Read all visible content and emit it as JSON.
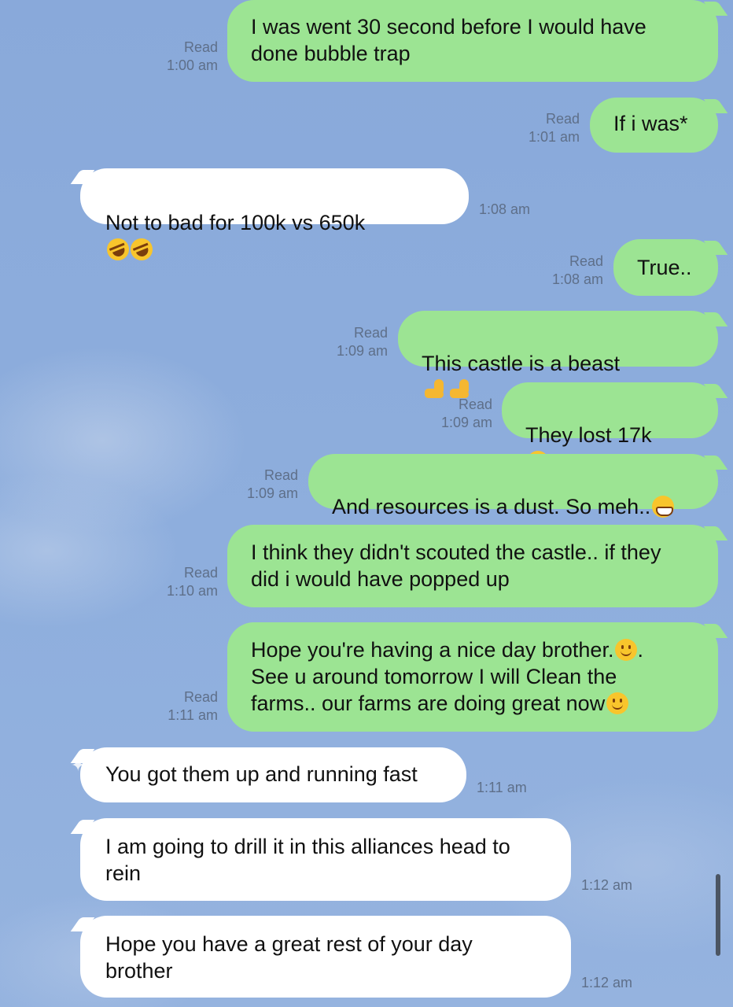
{
  "colors": {
    "background": "#8dabd9",
    "outgoing_bubble": "#9ce493",
    "incoming_bubble": "#ffffff",
    "meta_text": "#5e6f89"
  },
  "messages": [
    {
      "dir": "out",
      "text": "I was went 30 second before I would have\ndone bubble trap",
      "read": "Read",
      "time": "1:00 am"
    },
    {
      "dir": "out",
      "text": "If i was*",
      "read": "Read",
      "time": "1:01 am"
    },
    {
      "dir": "in",
      "text": "Not to bad for 100k vs 650k",
      "emoji": [
        "rolling-on-floor-laughing-icon",
        "rolling-on-floor-laughing-icon"
      ],
      "time": "1:08 am"
    },
    {
      "dir": "out",
      "text": "True..",
      "read": "Read",
      "time": "1:08 am"
    },
    {
      "dir": "out",
      "text": "This castle is a beast",
      "emoji": [
        "flexed-biceps-icon",
        "flexed-biceps-icon"
      ],
      "read": "Read",
      "time": "1:09 am"
    },
    {
      "dir": "out",
      "text": "They lost 17k",
      "emoji": [
        "tears-of-joy-icon"
      ],
      "read": "Read",
      "time": "1:09 am"
    },
    {
      "dir": "out",
      "text": "And resources is a dust. So meh..",
      "emoji": [
        "grinning-face-icon"
      ],
      "read": "Read",
      "time": "1:09 am"
    },
    {
      "dir": "out",
      "text": "I think they didn't scouted the castle.. if they\ndid i would have popped up",
      "read": "Read",
      "time": "1:10 am"
    },
    {
      "dir": "out",
      "line1": "Hope you're having a nice day brother.",
      "line1_end": ".",
      "line2": "See u around tomorrow I will Clean the",
      "line3": "farms.. our farms are doing great now",
      "emoji": [
        "slightly-smiling-face-icon",
        "slightly-smiling-face-icon"
      ],
      "read": "Read",
      "time": "1:11 am"
    },
    {
      "dir": "in",
      "text": "You got them up and running fast",
      "time": "1:11 am"
    },
    {
      "dir": "in",
      "text": "I am going to drill it in this alliances head to\nrein",
      "time": "1:12 am"
    },
    {
      "dir": "in",
      "text": "Hope you have a great rest of your day\nbrother",
      "time": "1:12 am"
    }
  ]
}
